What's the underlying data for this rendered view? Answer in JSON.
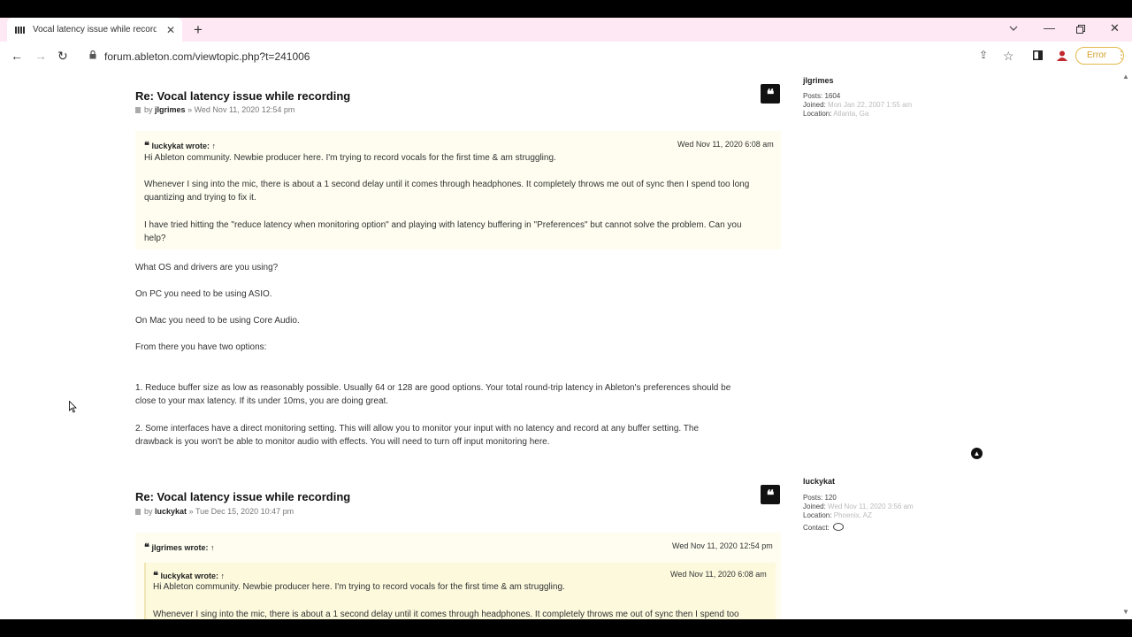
{
  "browser": {
    "tab_title": "Vocal latency issue while recording",
    "tab_close": "✕",
    "new_tab": "+",
    "url": "forum.ableton.com/viewtopic.php?t=241006",
    "error_label": "Error"
  },
  "posts": [
    {
      "title": "Re: Vocal latency issue while recording",
      "author": "jlgrimes",
      "date": "Wed Nov 11, 2020 12:54 pm",
      "quote": {
        "author": "luckykat wrote:",
        "date": "Wed Nov 11, 2020 6:08 am",
        "lines": [
          "Hi Ableton community. Newbie producer here. I'm trying to record vocals for the first time & am struggling.",
          "Whenever I sing into the mic, there is about a 1 second delay until it comes through headphones. It completely throws me out of sync then I spend too long",
          "quantizing and trying to fix it.",
          "I have tried hitting the \"reduce latency when monitoring option\" and playing with latency buffering in \"Preferences\" but cannot solve the problem. Can you",
          "help?"
        ]
      },
      "body": [
        "What OS and drivers are you using?",
        "On PC you need to be using ASIO.",
        "On Mac you need to be using Core Audio.",
        "From there you have two options:",
        "1. Reduce buffer size as low as reasonably possible. Usually 64 or 128 are good options. Your total round-trip latency in Ableton's preferences should be",
        "close to your max latency. If its under 10ms, you are doing great.",
        "2. Some interfaces have a direct monitoring setting. This will allow you to monitor your input with no latency and record at any buffer setting. The",
        "drawback is you won't be able to monitor audio with effects. You will need to turn off input monitoring here."
      ],
      "profile": {
        "name": "jlgrimes",
        "posts": "Posts: 1604",
        "joined_label": "Joined:",
        "joined": "Mon Jan 22, 2007 1:55 am",
        "location_label": "Location:",
        "location": "Atlanta, Ga"
      }
    },
    {
      "title": "Re: Vocal latency issue while recording",
      "author": "luckykat",
      "date": "Tue Dec 15, 2020 10:47 pm",
      "quote": {
        "author": "jlgrimes wrote:",
        "date": "Wed Nov 11, 2020 12:54 pm",
        "nested": {
          "author": "luckykat wrote:",
          "date": "Wed Nov 11, 2020 6:08 am",
          "lines": [
            "Hi Ableton community. Newbie producer here. I'm trying to record vocals for the first time & am struggling.",
            "Whenever I sing into the mic, there is about a 1 second delay until it comes through headphones. It completely throws me out of sync then I spend too"
          ]
        }
      },
      "profile": {
        "name": "luckykat",
        "posts": "Posts: 120",
        "joined_label": "Joined:",
        "joined": "Wed Nov 11, 2020 3:56 am",
        "location_label": "Location:",
        "location": "Phoenix, AZ",
        "contact": "Contact:"
      }
    }
  ],
  "common": {
    "by": "by",
    "sep": "»",
    "arrow": "↑",
    "quote_glyph": "❝"
  }
}
